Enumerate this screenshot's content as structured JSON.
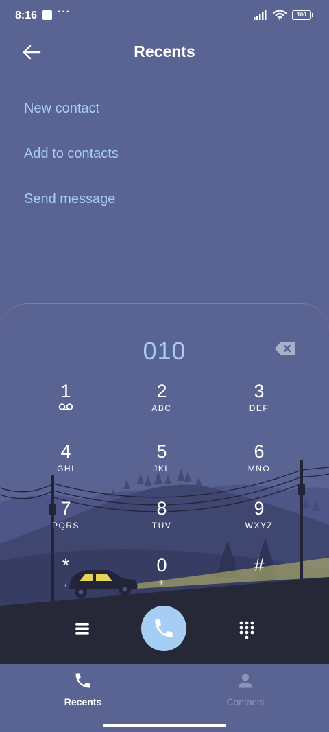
{
  "status_bar": {
    "time": "8:16",
    "more": "···",
    "battery": "100"
  },
  "header": {
    "title": "Recents"
  },
  "actions": [
    {
      "label": "New contact"
    },
    {
      "label": "Add to contacts"
    },
    {
      "label": "Send message"
    }
  ],
  "dialer": {
    "number": "010"
  },
  "keys": [
    {
      "digit": "1",
      "letters": ""
    },
    {
      "digit": "2",
      "letters": "ABC"
    },
    {
      "digit": "3",
      "letters": "DEF"
    },
    {
      "digit": "4",
      "letters": "GHI"
    },
    {
      "digit": "5",
      "letters": "JKL"
    },
    {
      "digit": "6",
      "letters": "MNO"
    },
    {
      "digit": "7",
      "letters": "PQRS"
    },
    {
      "digit": "8",
      "letters": "TUV"
    },
    {
      "digit": "9",
      "letters": "WXYZ"
    },
    {
      "digit": "*",
      "letters": ","
    },
    {
      "digit": "0",
      "letters": "+"
    },
    {
      "digit": "#",
      "letters": ""
    }
  ],
  "nav": {
    "recents": {
      "label": "Recents",
      "active": true
    },
    "contacts": {
      "label": "Contacts",
      "active": false
    }
  },
  "colors": {
    "background": "#5a6493",
    "accent": "#a6cdf3",
    "ground": "#262838"
  },
  "icons": {
    "back": "arrow-left-icon",
    "backspace": "backspace-icon",
    "voicemail": "voicemail-icon",
    "menu": "menu-icon",
    "call": "phone-icon",
    "keypad": "dialpad-icon",
    "recents": "phone-icon",
    "contacts": "person-icon"
  }
}
